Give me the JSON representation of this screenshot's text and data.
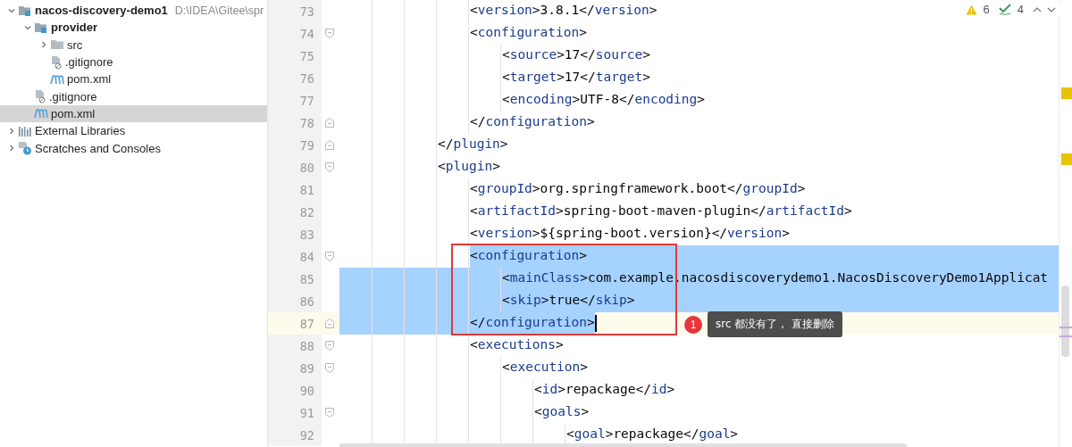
{
  "project_tree": {
    "items": [
      {
        "label": "nacos-discovery-demo1",
        "hint": "D:\\IDEA\\Gitee\\spr",
        "kind": "module",
        "expanded": true,
        "selected": false,
        "children": [
          {
            "label": "provider",
            "kind": "module",
            "expanded": true,
            "selected": false,
            "children": [
              {
                "label": "src",
                "kind": "folder",
                "expanded": false,
                "selected": false
              },
              {
                "label": ".gitignore",
                "kind": "ignored",
                "selected": false
              },
              {
                "label": "pom.xml",
                "kind": "maven",
                "selected": false
              }
            ]
          },
          {
            "label": ".gitignore",
            "kind": "ignored",
            "selected": false
          },
          {
            "label": "pom.xml",
            "kind": "maven",
            "selected": true
          }
        ]
      },
      {
        "label": "External Libraries",
        "kind": "libraries",
        "expanded": false,
        "selected": false
      },
      {
        "label": "Scratches and Consoles",
        "kind": "scratches",
        "expanded": false,
        "selected": false
      }
    ]
  },
  "editor": {
    "inspections": {
      "warnings": "6",
      "typos": "4"
    },
    "lines": [
      {
        "children": [
          {
            "number": "73",
            "selected": false,
            "code": "<version>3.8.1</version>"
          },
          {
            "number": "74",
            "kind": "fold_start",
            "selected": false,
            "code": "<configuration>",
            "children": [
              {
                "number": "75",
                "selected": false,
                "code": "<source>17</source>"
              },
              {
                "number": "76",
                "selected": false,
                "code": "<target>17</target>"
              },
              {
                "number": "77",
                "selected": false,
                "code": "<encoding>UTF-8</encoding>"
              }
            ]
          },
          {
            "number": "78",
            "kind": "fold_end",
            "selected": false,
            "code": "</configuration>"
          }
        ]
      },
      {
        "number": "79",
        "kind": "fold_end",
        "selected": false,
        "code": "</plugin>"
      },
      {
        "number": "80",
        "kind": "fold_start",
        "selected": false,
        "code": "<plugin>",
        "children": [
          {
            "number": "81",
            "selected": false,
            "code": "<groupId>org.springframework.boot</groupId>"
          },
          {
            "number": "82",
            "selected": false,
            "code": "<artifactId>spring-boot-maven-plugin</artifactId>"
          },
          {
            "number": "83",
            "selected": false,
            "code": "<version>${spring-boot.version}</version>"
          },
          {
            "number": "84",
            "kind": "fold_start",
            "selected": true,
            "code": "<configuration>",
            "children": [
              {
                "number": "85",
                "selected": true,
                "code": "<mainClass>com.example.nacosdiscoverydemo1.NacosDiscoveryDemo1Applicat"
              },
              {
                "number": "86",
                "selected": true,
                "code": "<skip>true</skip>"
              }
            ]
          },
          {
            "number": "87",
            "kind": "fold_end",
            "selected": true,
            "caret": true,
            "code": "</configuration>"
          },
          {
            "number": "88",
            "kind": "fold_start",
            "selected": false,
            "code": "<executions>",
            "children": [
              {
                "number": "89",
                "kind": "fold_start",
                "selected": false,
                "code": "<execution>",
                "children": [
                  {
                    "number": "90",
                    "selected": false,
                    "code": "<id>repackage</id>"
                  },
                  {
                    "number": "91",
                    "kind": "fold_start",
                    "selected": false,
                    "code": "<goals>",
                    "children": [
                      {
                        "number": "92",
                        "selected": false,
                        "code": "<goal>repackage</goal>"
                      }
                    ]
                  }
                ]
              }
            ]
          }
        ]
      }
    ]
  },
  "annotation": {
    "number": "1",
    "note": "src 都没有了， 直接删除"
  }
}
